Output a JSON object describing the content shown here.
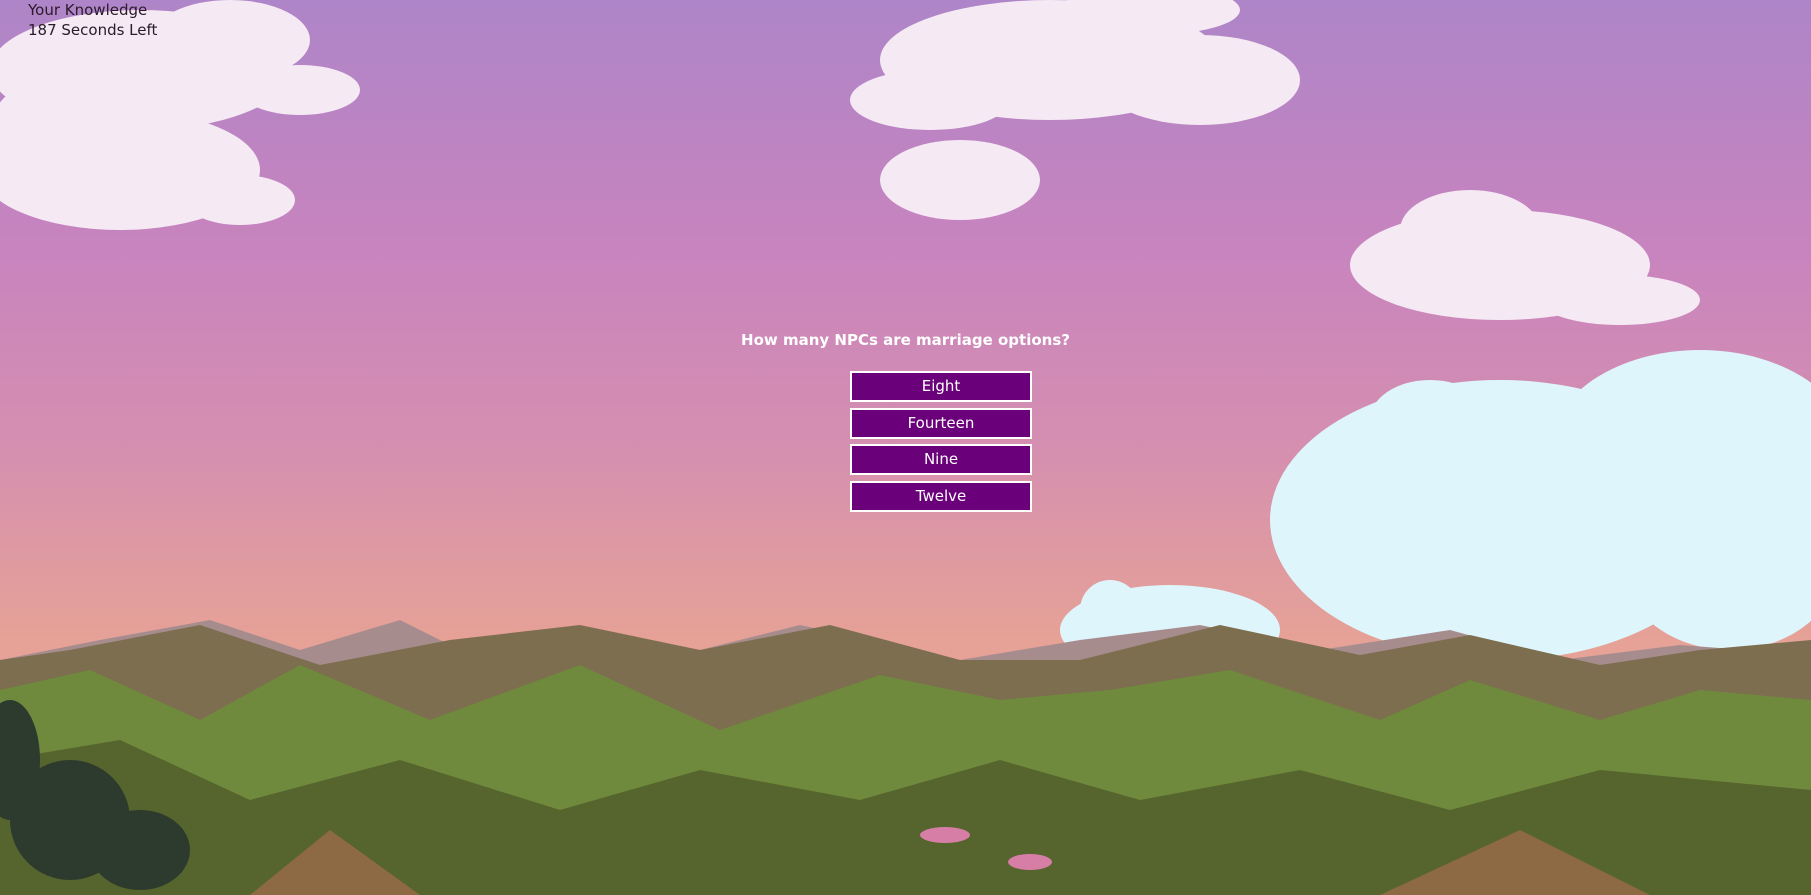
{
  "hud": {
    "title": "Your Knowledge",
    "timer": "187 Seconds Left"
  },
  "quiz": {
    "question": "How many NPCs are marriage options?",
    "answers": [
      "Eight",
      "Fourteen",
      "Nine",
      "Twelve"
    ]
  },
  "colors": {
    "button_bg": "#6b007b",
    "button_border": "#ffffff",
    "sky_top": "#ae85c8",
    "sky_mid": "#c884be",
    "sky_bottom": "#e6a296"
  }
}
